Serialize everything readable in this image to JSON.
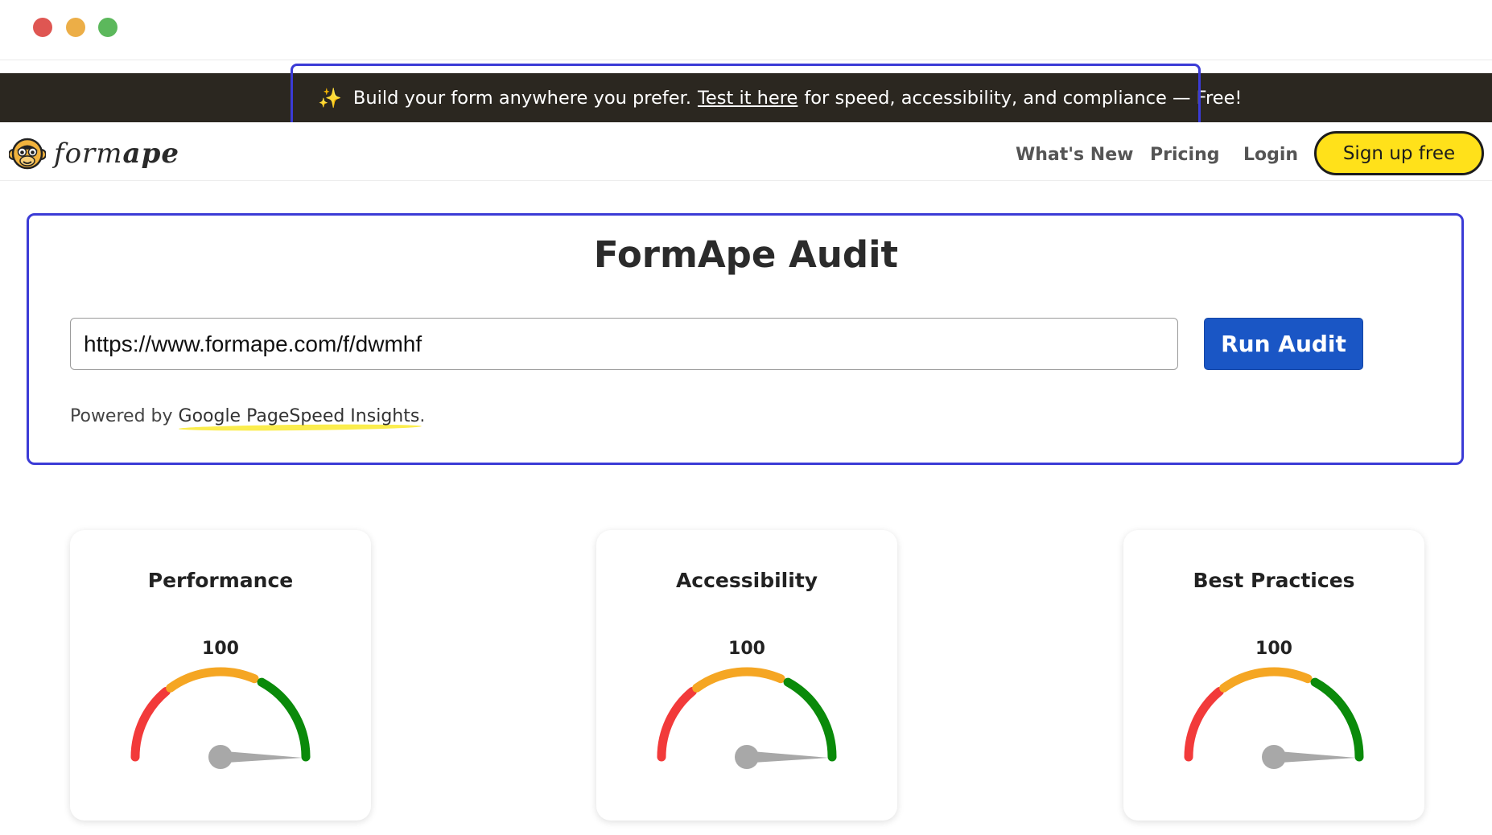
{
  "banner": {
    "text_before": "Build your form anywhere you prefer.",
    "link_text": "Test it here",
    "text_after": "for speed, accessibility, and compliance — Free!"
  },
  "nav": {
    "brand_part1": "form",
    "brand_part2": "ape",
    "links": [
      "What's New",
      "Pricing",
      "Login"
    ],
    "signup_label": "Sign up free"
  },
  "audit": {
    "title": "FormApe Audit",
    "url_value": "https://www.formape.com/f/dwmhf",
    "run_label": "Run Audit",
    "powered_prefix": "Powered by",
    "powered_link": "Google PageSpeed Insights",
    "powered_suffix": "."
  },
  "cards": [
    {
      "title": "Performance",
      "score": 100
    },
    {
      "title": "Accessibility",
      "score": 100
    },
    {
      "title": "Best Practices",
      "score": 100
    }
  ],
  "colors": {
    "banner_bg": "#2b2720",
    "accent_box": "#3b3bd6",
    "signup_bg": "#ffe11a",
    "run_button": "#1a56c5",
    "gauge_red": "#f23a3a",
    "gauge_orange": "#f5a623",
    "gauge_green": "#0a8a0a",
    "needle": "#a8a8a8"
  }
}
